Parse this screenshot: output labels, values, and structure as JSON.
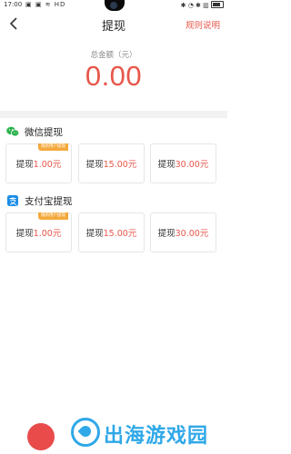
{
  "status_bar": {
    "time": "17:00",
    "left_icons": "▣ ▣ ≋ HD",
    "right_icons": "✱ ◔ ✱ ▥"
  },
  "nav": {
    "title": "提现",
    "rules_label": "规则说明"
  },
  "balance": {
    "label": "总金额（元）",
    "amount": "0.00"
  },
  "wechat": {
    "title": "微信提现",
    "options": [
      {
        "prefix": "提现",
        "amount": "1.00",
        "unit": "元",
        "tag": "限新用户提现"
      },
      {
        "prefix": "提现",
        "amount": "15.00",
        "unit": "元"
      },
      {
        "prefix": "提现",
        "amount": "30.00",
        "unit": "元"
      }
    ]
  },
  "alipay": {
    "title": "支付宝提现",
    "options": [
      {
        "prefix": "提现",
        "amount": "1.00",
        "unit": "元",
        "tag": "限新用户提现"
      },
      {
        "prefix": "提现",
        "amount": "15.00",
        "unit": "元"
      },
      {
        "prefix": "提现",
        "amount": "30.00",
        "unit": "元"
      }
    ]
  },
  "watermark": {
    "text": "出海游戏园"
  },
  "colors": {
    "accent": "#e8564a",
    "wechat_green": "#2bb24c",
    "alipay_blue": "#1b8de8",
    "tag_orange": "#f4a93c"
  }
}
